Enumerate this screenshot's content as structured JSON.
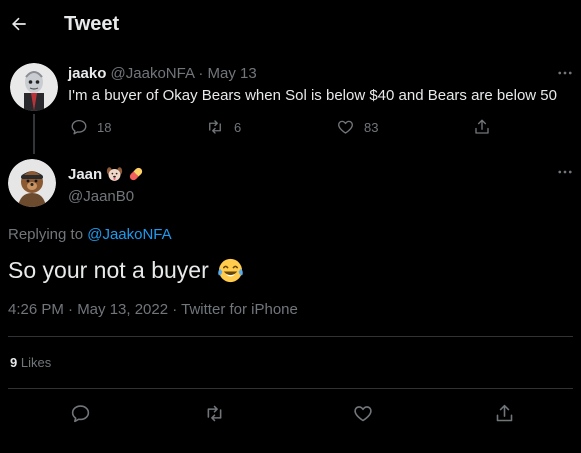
{
  "header": {
    "title": "Tweet",
    "back_icon": "arrow-left-icon"
  },
  "parent_tweet": {
    "author_name": "jaako",
    "author_handle": "@JaakoNFA",
    "separator": "·",
    "date": "May 13",
    "text": "I'm a buyer of Okay Bears when Sol is below $40 and Bears are below 50",
    "replies": "18",
    "retweets": "6",
    "likes": "83"
  },
  "main_tweet": {
    "author_name": "Jaan",
    "author_handle": "@JaanB0",
    "emoji_icons": [
      "dog-face-icon",
      "pill-icon"
    ],
    "replying_label": "Replying to",
    "replying_handle": "@JaakoNFA",
    "text": "So your not a buyer",
    "text_emoji": "face-with-tears-of-joy-icon",
    "meta": "4:26 PM · May 13, 2022 · Twitter for iPhone",
    "likes_count": "9",
    "likes_label": "Likes"
  },
  "colors": {
    "background": "#000000",
    "text": "#e7e9ea",
    "muted": "#71767b",
    "link": "#1d9bf0",
    "divider": "#2f3336"
  }
}
